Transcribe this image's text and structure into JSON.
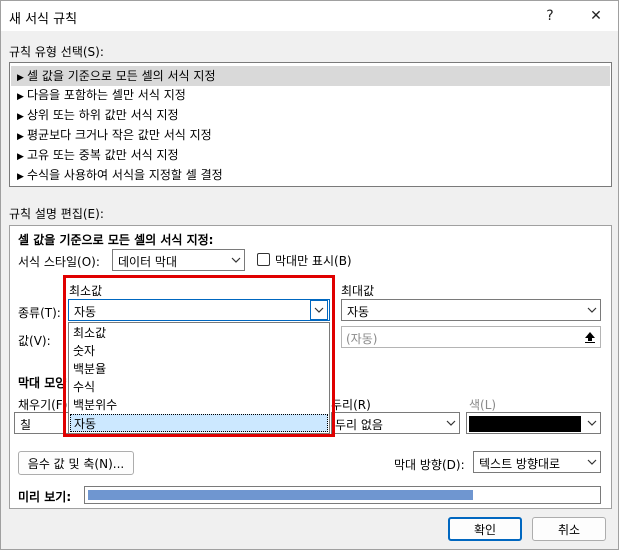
{
  "window": {
    "title": "새 서식 규칙",
    "help_label": "?",
    "close_label": "✕"
  },
  "rule_type": {
    "label": "규칙 유형 선택(S):",
    "items": [
      {
        "label": "셀 값을 기준으로 모든 셀의 서식 지정",
        "selected": true
      },
      {
        "label": "다음을 포함하는 셀만 서식 지정",
        "selected": false
      },
      {
        "label": "상위 또는 하위 값만 서식 지정",
        "selected": false
      },
      {
        "label": "평균보다 크거나 작은 값만 서식 지정",
        "selected": false
      },
      {
        "label": "고유 또는 중복 값만 서식 지정",
        "selected": false
      },
      {
        "label": "수식을 사용하여 서식을 지정할 셀 결정",
        "selected": false
      }
    ],
    "bullet": "▶"
  },
  "rule_desc": {
    "label": "규칙 설명 편집(E):",
    "heading": "셀 값을 기준으로 모든 셀의 서식 지정:",
    "format_style_label": "서식 스타일(O):",
    "format_style_value": "데이터 막대",
    "bar_only_label": "막대만 표시(B)",
    "min_header": "최소값",
    "max_header": "최대값",
    "type_label": "종류(T):",
    "value_label": "값(V):",
    "min_type_value": "자동",
    "max_type_value": "자동",
    "max_value_placeholder": "(자동)",
    "bar_appearance_label": "막대 모양",
    "fill_label": "채우기(F)",
    "fill_value": "칠",
    "border_label": "두리(R)",
    "border_value": "두리 없음",
    "color_label": "색(L)",
    "color_value": "#000000",
    "negative_axis_button": "음수 값 및 축(N)...",
    "bar_direction_label": "막대 방향(D):",
    "bar_direction_value": "텍스트 방향대로",
    "preview_label": "미리 보기:",
    "preview_fill_color": "#6f96d0"
  },
  "dropdown": {
    "options": [
      "최소값",
      "숫자",
      "백분율",
      "수식",
      "백분위수",
      "자동"
    ],
    "selected_index": 5,
    "highlight_color": "#e00000"
  },
  "footer": {
    "ok_label": "확인",
    "cancel_label": "취소"
  }
}
